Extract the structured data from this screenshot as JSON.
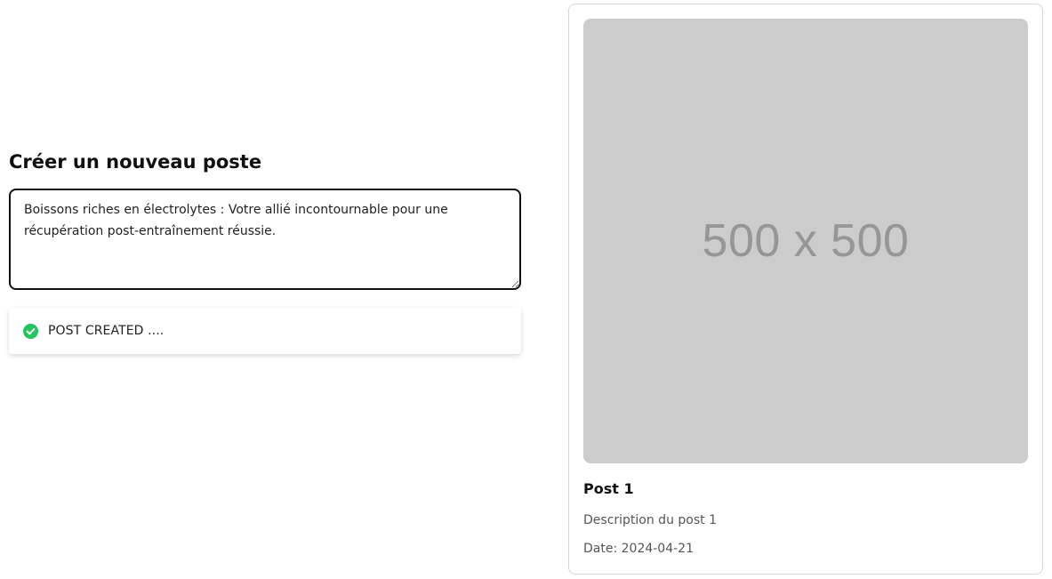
{
  "create_post": {
    "title": "Créer un nouveau poste",
    "textarea_value": "Boissons riches en électrolytes : Votre allié incontournable pour une récupération post-entraînement réussie."
  },
  "toast": {
    "icon": "check-circle-icon",
    "icon_color": "#22c55e",
    "message": "POST CREATED ...."
  },
  "post_card": {
    "image_placeholder": "500 x 500",
    "title": "Post 1",
    "description": "Description du post 1",
    "date": "Date: 2024-04-21"
  }
}
